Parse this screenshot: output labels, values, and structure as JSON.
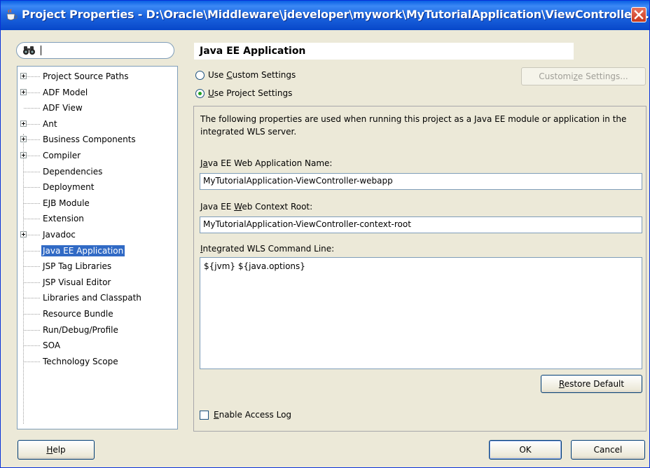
{
  "window": {
    "title": "Project Properties - D:\\Oracle\\Middleware\\jdeveloper\\mywork\\MyTutorialApplication\\ViewController\\..."
  },
  "search": {
    "value": ""
  },
  "tree": {
    "items": [
      {
        "label": "Project Source Paths",
        "expandable": true
      },
      {
        "label": "ADF Model",
        "expandable": true
      },
      {
        "label": "ADF View",
        "expandable": false
      },
      {
        "label": "Ant",
        "expandable": true
      },
      {
        "label": "Business Components",
        "expandable": true
      },
      {
        "label": "Compiler",
        "expandable": true
      },
      {
        "label": "Dependencies",
        "expandable": false
      },
      {
        "label": "Deployment",
        "expandable": false
      },
      {
        "label": "EJB Module",
        "expandable": false
      },
      {
        "label": "Extension",
        "expandable": false
      },
      {
        "label": "Javadoc",
        "expandable": true
      },
      {
        "label": "Java EE Application",
        "expandable": false,
        "selected": true
      },
      {
        "label": "JSP Tag Libraries",
        "expandable": false
      },
      {
        "label": "JSP Visual Editor",
        "expandable": false
      },
      {
        "label": "Libraries and Classpath",
        "expandable": false
      },
      {
        "label": "Resource Bundle",
        "expandable": false
      },
      {
        "label": "Run/Debug/Profile",
        "expandable": false
      },
      {
        "label": "SOA",
        "expandable": false
      },
      {
        "label": "Technology Scope",
        "expandable": false
      }
    ]
  },
  "page": {
    "title": "Java EE Application",
    "radio_custom": {
      "pre": "Use ",
      "ul": "C",
      "post": "ustom Settings",
      "checked": false
    },
    "radio_project": {
      "pre": "",
      "ul": "U",
      "post": "se Project Settings",
      "checked": true
    },
    "customize_button": {
      "pre": "Customi",
      "ul": "z",
      "post": "e Settings..."
    },
    "description": "The following properties are used when running this project as a Java EE module or application in the integrated WLS server.",
    "web_app_name": {
      "label_pre": "J",
      "label_ul": "a",
      "label_post": "va EE Web Application Name:",
      "value": "MyTutorialApplication-ViewController-webapp"
    },
    "context_root": {
      "label_pre": "Java EE ",
      "label_ul": "W",
      "label_post": "eb Context Root:",
      "value": "MyTutorialApplication-ViewController-context-root"
    },
    "command_line": {
      "label_pre": "",
      "label_ul": "I",
      "label_post": "ntegrated WLS Command Line:",
      "value": "${jvm} ${java.options}"
    },
    "restore_button": {
      "pre": "",
      "ul": "R",
      "post": "estore Default"
    },
    "access_log": {
      "pre": "",
      "ul": "E",
      "post": "nable Access Log",
      "checked": false
    }
  },
  "footer": {
    "help_button": {
      "pre": "",
      "ul": "H",
      "post": "elp"
    },
    "ok_label": "OK",
    "cancel_label": "Cancel"
  },
  "colors": {
    "title_bar": "#0a5fe3",
    "selection": "#316ac5",
    "dialog_bg": "#ece9d8"
  },
  "icons": {
    "title": "java-cup-icon",
    "search": "binoculars-icon",
    "close": "close-icon"
  }
}
